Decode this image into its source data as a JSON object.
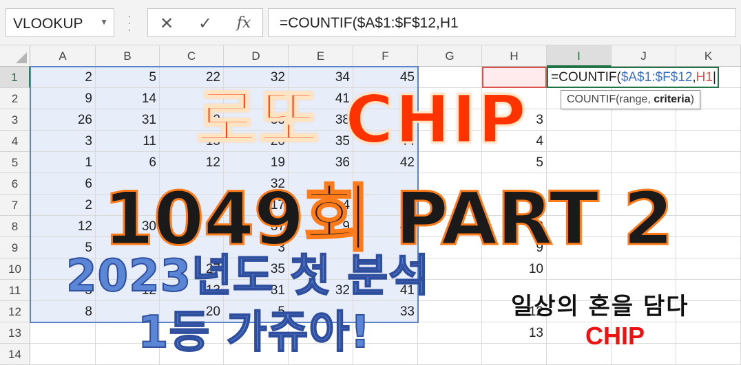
{
  "formula_bar": {
    "name_box": "VLOOKUP",
    "cancel_icon": "✕",
    "enter_icon": "✓",
    "function_icon": "fx",
    "formula": "=COUNTIF($A$1:$F$12,H1"
  },
  "columns": [
    "A",
    "B",
    "C",
    "D",
    "E",
    "F",
    "G",
    "H",
    "I",
    "J",
    "K"
  ],
  "rows": [
    "1",
    "2",
    "3",
    "4",
    "5",
    "6",
    "7",
    "8",
    "9",
    "10",
    "11",
    "12",
    "13",
    "14"
  ],
  "data": [
    [
      "2",
      "5",
      "22",
      "32",
      "34",
      "45"
    ],
    [
      "9",
      "14",
      "",
      "",
      "41",
      "42"
    ],
    [
      "26",
      "31",
      "32",
      "33",
      "38",
      "40"
    ],
    [
      "3",
      "11",
      "15",
      "20",
      "35",
      "44"
    ],
    [
      "1",
      "6",
      "12",
      "19",
      "36",
      "42"
    ],
    [
      "6",
      "",
      "",
      "32",
      "",
      ""
    ],
    [
      "2",
      "",
      "",
      "17",
      "4",
      ""
    ],
    [
      "12",
      "30",
      "",
      "37",
      "9",
      "41"
    ],
    [
      "5",
      "",
      "",
      "3",
      "",
      ""
    ],
    [
      "4",
      "6",
      "27",
      "35",
      "",
      ""
    ],
    [
      "5",
      "12",
      "13",
      "31",
      "32",
      "41"
    ],
    [
      "8",
      "",
      "20",
      "5",
      "",
      "33"
    ]
  ],
  "col_h": [
    "",
    "",
    "3",
    "4",
    "5",
    "",
    "7",
    "8",
    "9",
    "10",
    "",
    "12",
    "13",
    ""
  ],
  "active_cell": {
    "prefix": "=COUNTIF(",
    "range": "$A$1:$F$12",
    "comma": ",",
    "ref": "H1"
  },
  "tooltip": {
    "plain": "COUNTIF(range, ",
    "bold": "criteria",
    "close": ")"
  },
  "overlay": {
    "title": "로또 CHIP",
    "subtitle": "1049회 PART 2",
    "line3": "2023년도 첫 분석",
    "line4": "1등 가쥬아!",
    "tagline": "일상의 혼을 담다",
    "brand": "CHIP"
  },
  "colors": {
    "accent_green": "#217346",
    "range_blue": "#5b83c7",
    "ref_red": "#d9534f"
  }
}
